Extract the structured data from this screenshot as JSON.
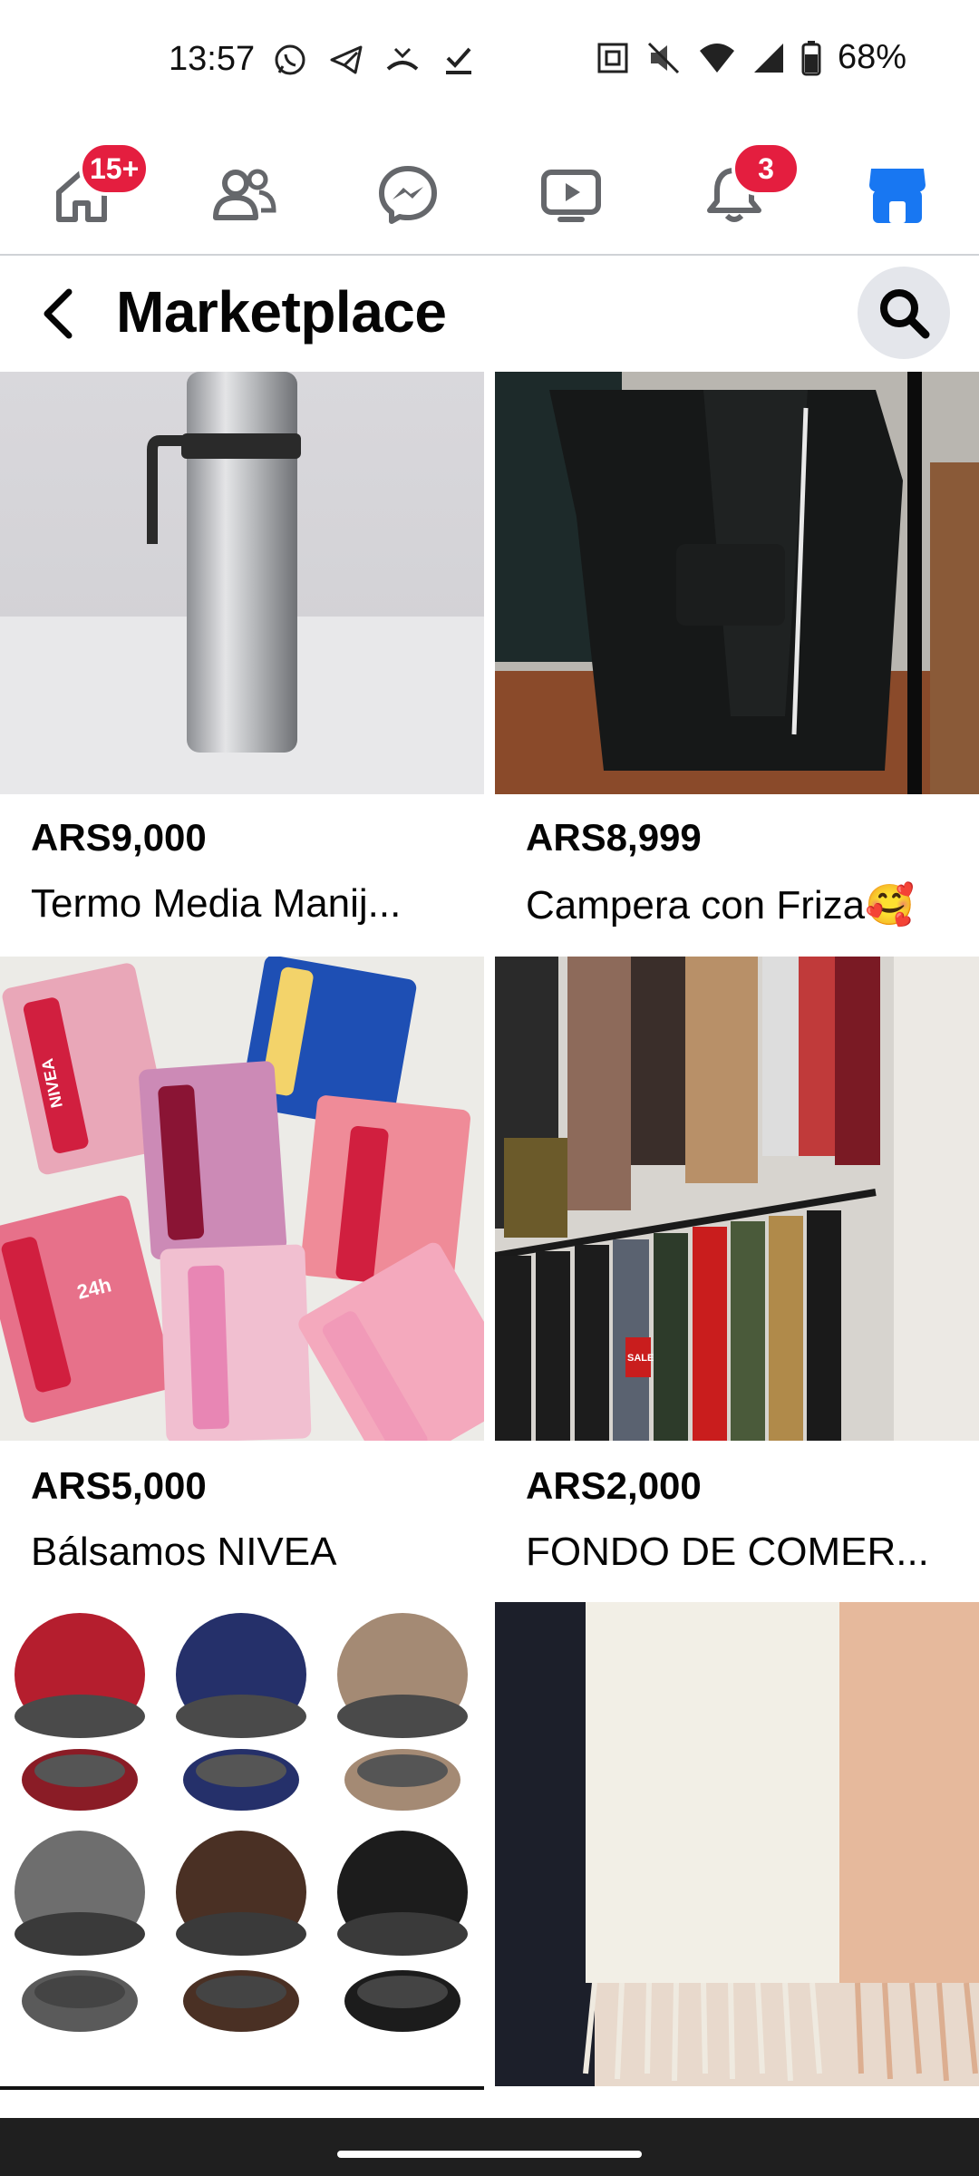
{
  "status": {
    "time": "13:57",
    "battery": "68%"
  },
  "nav": {
    "home_badge": "15+",
    "notifications_badge": "3"
  },
  "header": {
    "title": "Marketplace"
  },
  "listings": [
    {
      "price": "ARS9,000",
      "title": "Termo Media Manij..."
    },
    {
      "price": "ARS8,999",
      "title": "Campera con Friza🥰"
    },
    {
      "price": "ARS5,000",
      "title": "Bálsamos NIVEA"
    },
    {
      "price": "ARS2,000",
      "title": "FONDO DE COMER..."
    },
    {
      "price": "",
      "title": ""
    },
    {
      "price": "",
      "title": ""
    }
  ],
  "image_text": {
    "nivea_brand": "NIVEA",
    "nivea_24h": "24h",
    "sale": "SALE"
  },
  "colors": {
    "accent": "#1877f2",
    "badge": "#e41e3f",
    "search_bg": "#e4e6eb"
  }
}
